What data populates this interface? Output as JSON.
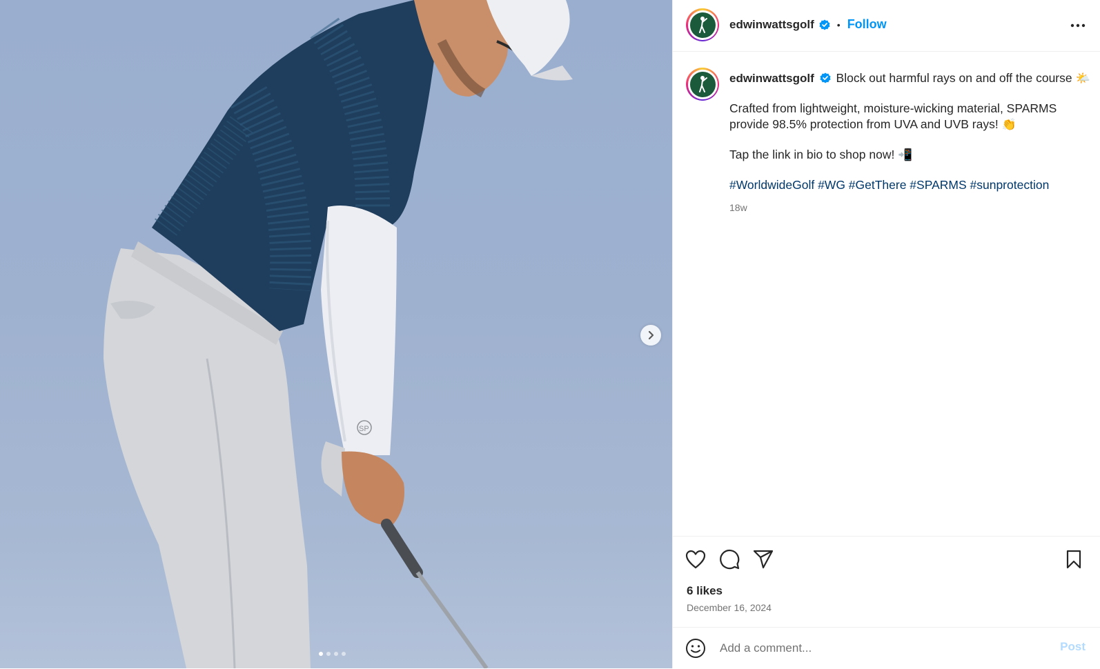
{
  "post": {
    "username": "edwinwattsgolf",
    "follow_label": "Follow",
    "separator": "•",
    "caption": {
      "headline": "Block out harmful rays on and off the course",
      "headline_emoji": "🌤️",
      "paragraph": "Crafted from lightweight, moisture-wicking material, SPARMS provide 98.5% protection from UVA and UVB rays!",
      "paragraph_emoji": "👏",
      "cta": "Tap the link in bio to shop now!",
      "cta_emoji": "📲",
      "hashtags": "#WorldwideGolf #WG #GetThere #SPARMS #sunprotection",
      "age": "18w"
    },
    "likes": "6 likes",
    "date": "December 16, 2024"
  },
  "media": {
    "slide_count": 4,
    "active_slide": 1,
    "sleeve_logo": "SP"
  },
  "comment": {
    "placeholder": "Add a comment...",
    "post_label": "Post"
  },
  "icons": {
    "more": "more-horizontal-icon",
    "next": "chevron-right-icon",
    "like": "heart-icon",
    "comment": "comment-bubble-icon",
    "share": "paper-plane-icon",
    "save": "bookmark-icon",
    "emoji": "smiley-icon"
  },
  "colors": {
    "link_blue": "#0095f6",
    "hashtag": "#00376b",
    "logo_green": "#1c5a3c",
    "post_disabled": "#b3dbff"
  }
}
